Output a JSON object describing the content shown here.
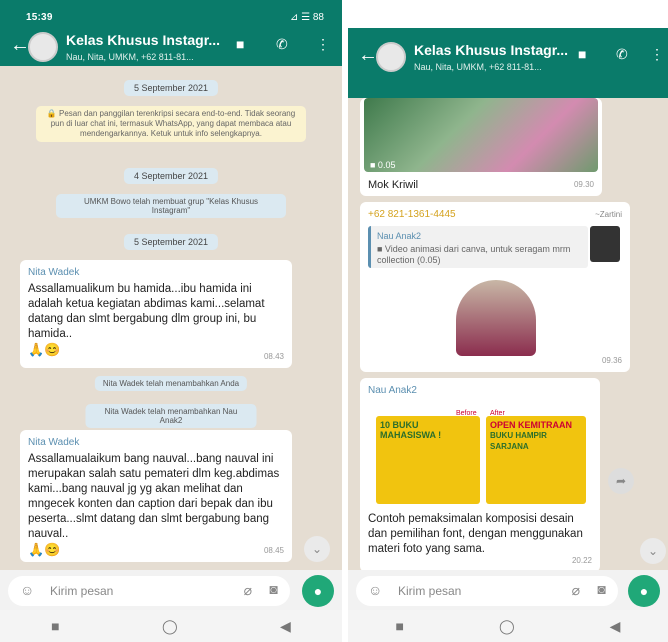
{
  "left": {
    "status_time": "15:39",
    "status_right": "⊿ ☰ 88",
    "title": "Kelas Khusus Instagr...",
    "subtitle": "Nau, Nita, UMKM, +62 811-81...",
    "date1": "5 September 2021",
    "encryption": "🔒 Pesan dan panggilan terenkripsi secara end-to-end. Tidak seorang pun di luar chat ini, termasuk WhatsApp, yang dapat membaca atau mendengarkannya. Ketuk untuk info selengkapnya.",
    "date2": "4 September 2021",
    "created": "UMKM Bowo telah membuat grup \"Kelas Khusus Instagram\"",
    "date3": "5 September 2021",
    "msg1": {
      "sender": "Nita Wadek",
      "text": "Assallamualikum bu hamida...ibu hamida ini adalah ketua kegiatan abdimas kami...selamat datang dan slmt bergabung dlm group ini, bu hamida..",
      "emoji": "🙏😊",
      "time": "08.43"
    },
    "sys1": "Nita Wadek telah menambahkan Anda",
    "sys2": "Nita Wadek telah menambahkan Nau Anak2",
    "msg2": {
      "sender": "Nita Wadek",
      "text": "Assallamualaikum bang nauval...bang nauval ini merupakan salah satu pemateri dlm keg.abdimas kami...bang nauval jg yg akan melihat dan mngecek konten dan caption dari bepak dan ibu peserta...slmt datang dan slmt bergabung bang nauval..",
      "emoji": "🙏😊",
      "time": "08.45"
    },
    "input_placeholder": "Kirim pesan"
  },
  "right": {
    "status_time": "15:40",
    "status_right": "⊿ ☰ 88",
    "title": "Kelas Khusus Instagr...",
    "subtitle": "Nau, Nita, UMKM, +62 811-81...",
    "video_duration": "■ 0.05",
    "video_caption": "Mok Kriwil",
    "video_time": "09.30",
    "reply_sender": "+62 821-1361-4445",
    "reply_tag": "~Zartini",
    "quote_sender": "Nau Anak2",
    "quote_text": "■ Video animasi dari canva, untuk seragam mrm collection (0.05)",
    "sticker_time": "09.36",
    "msg_sender": "Nau Anak2",
    "poster_before": "Before",
    "poster_after": "After",
    "poster1_title": "10 BUKU MAHASISWA !",
    "poster2_title": "OPEN KEMITRAAN",
    "poster2_sub": "BUKU HAMPIR SARJANA",
    "msg_text": "Contoh pemaksimalan komposisi desain dan pemilihan font, dengan menggunakan materi foto yang sama.",
    "msg_time": "20.22",
    "input_placeholder": "Kirim pesan"
  },
  "colors": {
    "header": "#0a7b6a",
    "chat_bg": "#e5ddd2",
    "accent": "#20a878",
    "poster_yellow": "#f1c40f"
  }
}
